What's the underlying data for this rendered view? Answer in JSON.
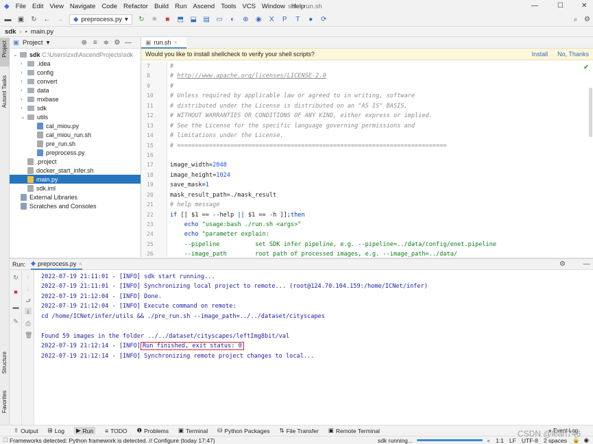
{
  "window": {
    "title": "sdk - run.sh"
  },
  "menu": [
    "File",
    "Edit",
    "View",
    "Navigate",
    "Code",
    "Refactor",
    "Build",
    "Run",
    "Ascend",
    "Tools",
    "VCS",
    "Window",
    "Help"
  ],
  "toolbar": {
    "run_config": "preprocess.py"
  },
  "breadcrumb": [
    "sdk",
    "main.py"
  ],
  "left_stripe": [
    "Project",
    "Automl Tasks",
    "Structure",
    "Favorites"
  ],
  "project": {
    "title": "Project",
    "root": "sdk",
    "root_path": "C:\\Users\\zxd\\AscendProjects\\sdk",
    "folders": [
      ".idea",
      "config",
      "convert",
      "data",
      "mxbase",
      "sdk",
      "utils"
    ],
    "utils_files": [
      "cal_miou.py",
      "cal_miou_run.sh",
      "pre_run.sh",
      "preprocess.py"
    ],
    "root_files": [
      ".project",
      "docker_start_infer.sh",
      "main.py",
      "sdk.iml"
    ],
    "extra": [
      "External Libraries",
      "Scratches and Consoles"
    ]
  },
  "editor": {
    "tab": "run.sh",
    "banner": "Would you like to install shellcheck to verify your shell scripts?",
    "install": "Install",
    "no_thanks": "No, Thanks",
    "line_numbers": [
      "7",
      "8",
      "9",
      "10",
      "11",
      "12",
      "13",
      "14",
      "15",
      "16",
      "17",
      "18",
      "19",
      "20",
      "21",
      "22",
      "23",
      "24",
      "25",
      "26"
    ],
    "lines": [
      [
        [
          "c",
          "#"
        ]
      ],
      [
        [
          "c",
          "# "
        ],
        [
          "u",
          "http://www.apache.org/licenses/LICENSE-2.0"
        ]
      ],
      [
        [
          "c",
          "#"
        ]
      ],
      [
        [
          "c",
          "# Unless required by applicable law or agreed to in writing, software"
        ]
      ],
      [
        [
          "c",
          "# distributed under the License is distributed on an \"AS IS\" BASIS,"
        ]
      ],
      [
        [
          "c",
          "# WITHOUT WARRANTIES OR CONDITIONS OF ANY KIND, either express or implied."
        ]
      ],
      [
        [
          "c",
          "# See the License for the specific language governing permissions and"
        ]
      ],
      [
        [
          "c",
          "# limitations under the License."
        ]
      ],
      [
        [
          "c",
          "# ============================================================================"
        ]
      ],
      [
        [
          "p",
          ""
        ]
      ],
      [
        [
          "p",
          "image_width="
        ],
        [
          "n",
          "2048"
        ]
      ],
      [
        [
          "p",
          "image_height="
        ],
        [
          "n",
          "1024"
        ]
      ],
      [
        [
          "p",
          "save_mask="
        ],
        [
          "n",
          "1"
        ]
      ],
      [
        [
          "p",
          "mask_result_path=./mask_result"
        ]
      ],
      [
        [
          "c",
          "# help message"
        ]
      ],
      [
        [
          "k",
          "if"
        ],
        [
          "p",
          " [[ $1 == --help "
        ],
        [
          "k",
          "||"
        ],
        [
          "p",
          " $1 == -h ]];"
        ],
        [
          "k",
          "then"
        ]
      ],
      [
        [
          "p",
          "    "
        ],
        [
          "k",
          "echo"
        ],
        [
          "s",
          " \"usage:bash ./run.sh <args>\""
        ]
      ],
      [
        [
          "p",
          "    "
        ],
        [
          "k",
          "echo"
        ],
        [
          "s",
          " \"parameter explain:"
        ]
      ],
      [
        [
          "s",
          "    --pipeline          set SDK infer pipeline, e.g. --pipeline=../data/config/enet.pipeline"
        ]
      ],
      [
        [
          "s",
          "    --image_path        root path of processed images, e.g. --image_path=../data/"
        ]
      ]
    ]
  },
  "run": {
    "label": "Run:",
    "tab": "preprocess.py",
    "output": [
      "2022-07-19 21:11:01 - [INFO] sdk start running...",
      "2022-07-19 21:11:01 - [INFO] Synchronizing local project to remote... (root@124.70.104.159:/home/ICNet/infer)",
      "2022-07-19 21:12:04 - [INFO] Done.",
      "2022-07-19 21:12:04 - [INFO] Execute command on remote:",
      "cd /home/ICNet/infer/utils && ./pre_run.sh --image_path=../../dataset/cityscapes",
      "",
      "Found 59 images in the folder ../../dataset/cityscapes/leftImg8bit/val"
    ],
    "finished_prefix": "2022-07-19 21:12:14 - [INFO]",
    "finished_msg": "Run finished, exit status: 0",
    "last_line": "2022-07-19 21:12:14 - [INFO] Synchronizing remote project changes to local..."
  },
  "tool_tabs": [
    "Output",
    "Log",
    "Run",
    "TODO",
    "Problems",
    "Terminal",
    "Python Packages",
    "File Transfer",
    "Remote Terminal"
  ],
  "event_log": "Event Log",
  "status": {
    "message": "Frameworks detected: Python framework is detected. // Configure (today 17:47)",
    "task": "sdk running...",
    "position": "1:1",
    "line_sep": "LF",
    "encoding": "UTF-8",
    "indent": "2 spaces",
    "watermark": "CSDN @lean746"
  }
}
